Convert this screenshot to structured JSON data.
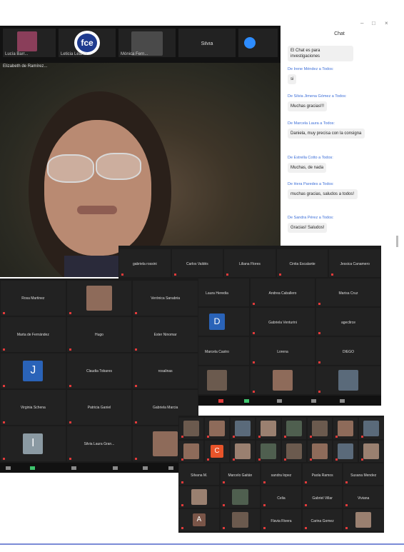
{
  "window_controls": {
    "minimize": "–",
    "maximize": "□",
    "close": "×"
  },
  "top_strip": {
    "tiles": [
      {
        "name": "Lucía Barr..."
      },
      {
        "name": "Leticia Leandr...",
        "logo": "fce"
      },
      {
        "name": "Mónica Fern..."
      },
      {
        "name": "Silvia"
      }
    ]
  },
  "speaker": {
    "label": "Elizabeth de Ramírez..."
  },
  "chat": {
    "title": "Chat",
    "messages": [
      {
        "sender": "",
        "text": "El Chat es para investigaciones"
      },
      {
        "sender": "De Irene Méndez a Todos:",
        "text": "si"
      },
      {
        "sender": "De Silvia Jimena Gómez a Todos:",
        "text": "Muchas gracias!!!"
      },
      {
        "sender": "De Marcela Laura a Todos:",
        "text": "Daniela, muy precisa con la consigna"
      },
      {
        "sender": "De Estrella Cotto a Todos:",
        "text": "Muchas, de nada"
      },
      {
        "sender": "De Hera Paredes a Todos:",
        "text": "muchas gracias, saludos a todos!"
      },
      {
        "sender": "De Sandra Pérez a Todos:",
        "text": "Gracias! Saludos!"
      }
    ]
  },
  "gallery_a": {
    "rows": [
      [
        "Rosa Martinez",
        "",
        "Verónica Sanabria"
      ],
      [
        "Marta de Fernández",
        "Hugo",
        "Ester Ninomar"
      ],
      [
        "J",
        "Claudia Tobares",
        "rosalinas"
      ],
      [
        "Virginia Schena",
        "Patricia Ganiel",
        "Gabriela Marcia"
      ],
      [
        "I",
        "Silvia Laura Gran...",
        ""
      ]
    ]
  },
  "gallery_b": {
    "rows": [
      [
        "gabriela rossini",
        "Carlos Valdés",
        "Liliana Flores",
        "Cintia Escalante",
        "Jessica Canamero"
      ],
      [
        "",
        "Laura Heredia",
        "Andrea Caballero",
        "Marisa Cruz"
      ],
      [
        "",
        "D",
        "Gabriela Venturini",
        "ageclirce"
      ],
      [
        "",
        "Marcela Castro",
        "Lorena",
        "DIEGO"
      ],
      [
        "",
        "",
        "",
        ""
      ]
    ]
  },
  "gallery_c": {
    "rows": [
      [
        "",
        "",
        "",
        "",
        "",
        "",
        "",
        ""
      ],
      [
        "",
        "C",
        "",
        "",
        "",
        "",
        "",
        ""
      ],
      [
        "Silvana M.",
        "Marcelo Gaitán",
        "sandra lopez",
        "Paola Ramos",
        "Susana Mendez"
      ],
      [
        "",
        "",
        "Celia",
        "Gabriel Villar",
        "Viviana"
      ],
      [
        "A",
        "",
        "Flavia Rivera",
        "Carina Gomez",
        ""
      ]
    ]
  },
  "colors": {
    "accent_line": "#7b8bd6",
    "chat_sender": "#3d6fd8",
    "mic_muted": "#e03a3a",
    "zoom_blue": "#2d8cff"
  }
}
